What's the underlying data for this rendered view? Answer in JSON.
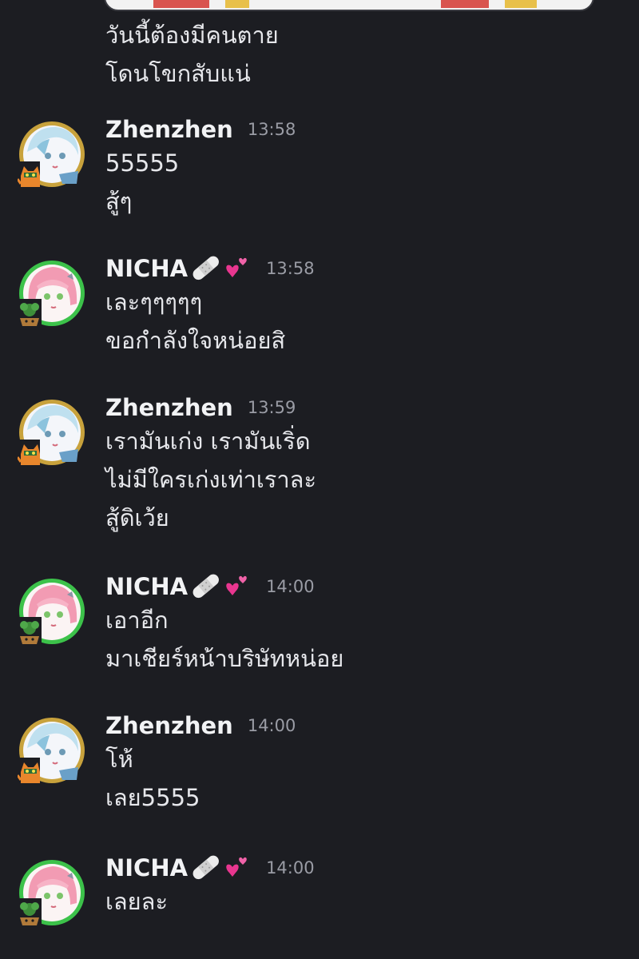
{
  "continuation_lines": [
    "วันนี้ต้องมีคนตาย",
    "โดนโขกสับแน่"
  ],
  "messages": [
    {
      "author": "Zhenzhen",
      "time": "13:58",
      "lines": [
        "55555",
        "สู้ๆ"
      ],
      "avatar": "zhenzhen-avatar"
    },
    {
      "author": "NICHA",
      "decor": [
        "bandage-emoji",
        "two-hearts-emoji"
      ],
      "time": "13:58",
      "lines": [
        "เละๆๆๆๆๆ",
        "ขอกำลังใจหน่อยสิ"
      ],
      "avatar": "nicha-avatar"
    },
    {
      "author": "Zhenzhen",
      "time": "13:59",
      "lines": [
        "เรามันเก่ง เรามันเริ่ด",
        "ไม่มีใครเก่งเท่าเราละ",
        "สู้ดิเว้ย"
      ],
      "avatar": "zhenzhen-avatar"
    },
    {
      "author": "NICHA",
      "decor": [
        "bandage-emoji",
        "two-hearts-emoji"
      ],
      "time": "14:00",
      "lines": [
        "เอาอีก",
        "มาเชียร์หน้าบริษัทหน่อย"
      ],
      "avatar": "nicha-avatar"
    },
    {
      "author": "Zhenzhen",
      "time": "14:00",
      "lines": [
        "โห้",
        "เลย5555"
      ],
      "avatar": "zhenzhen-avatar"
    },
    {
      "author": "NICHA",
      "decor": [
        "bandage-emoji",
        "two-hearts-emoji"
      ],
      "time": "14:00",
      "lines": [
        "เลยละ"
      ],
      "avatar": "nicha-avatar"
    }
  ],
  "colors": {
    "background": "#1c1d22",
    "text": "#e6e7eb",
    "username": "#f2f3f5",
    "timestamp": "#9a9ca5",
    "zhenzhen_frame": "#c8a23c",
    "nicha_frame": "#3cc24a"
  }
}
